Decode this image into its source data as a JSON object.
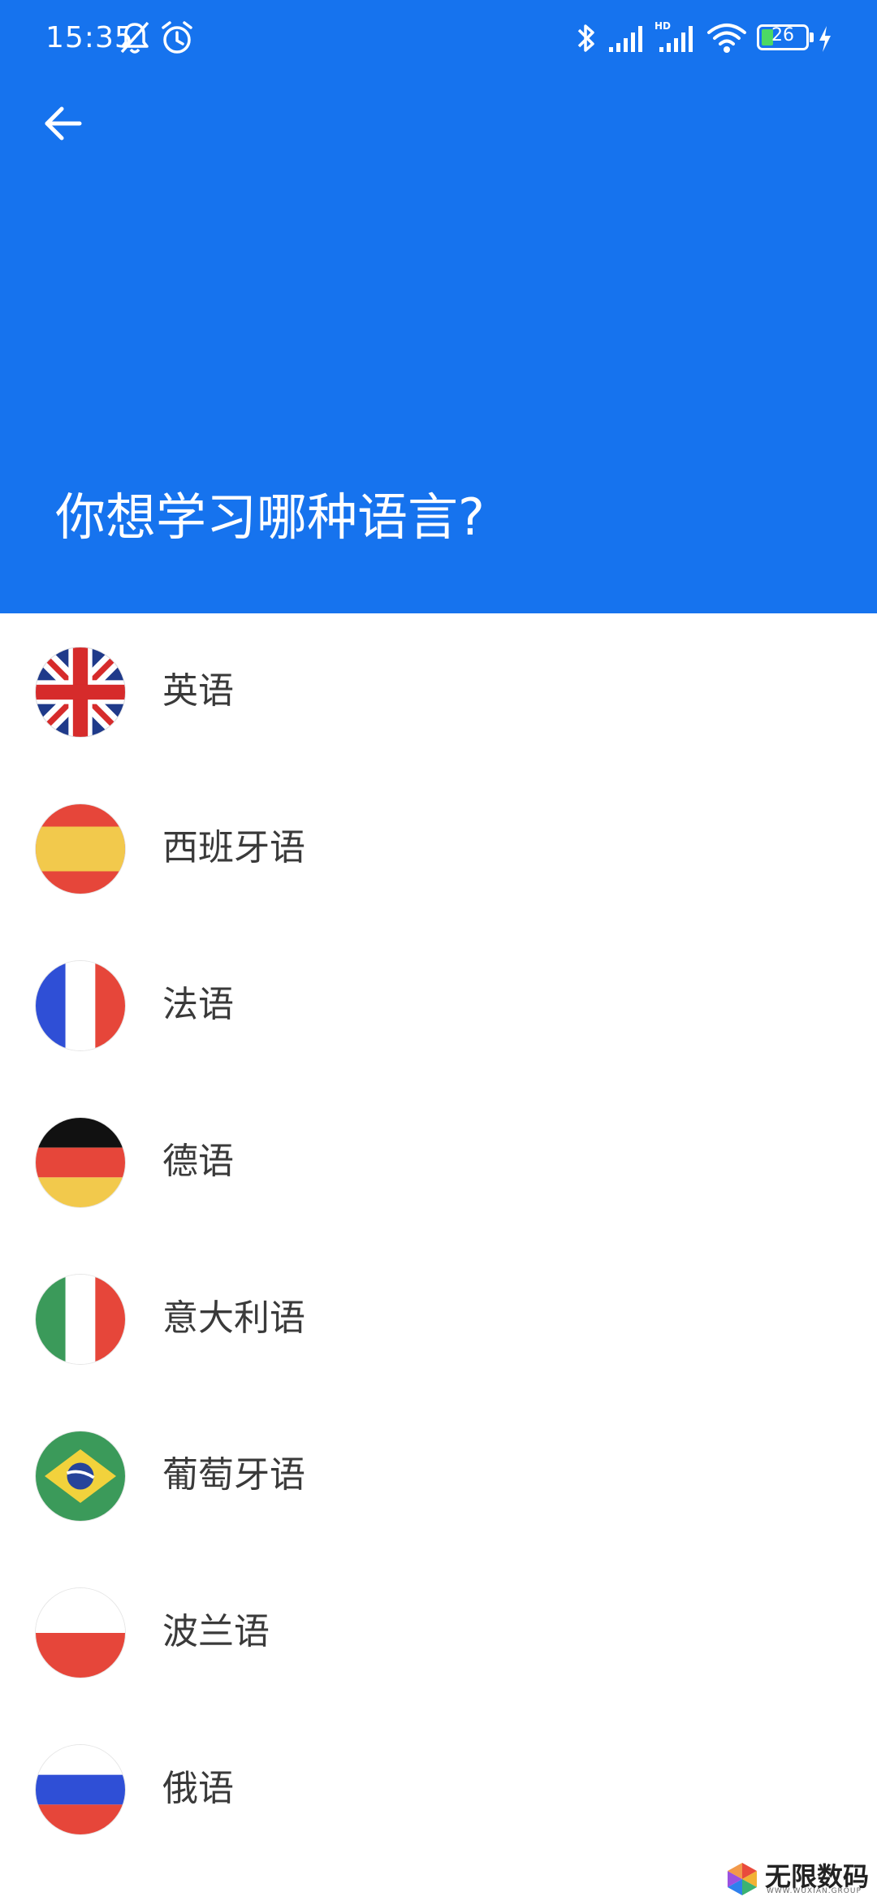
{
  "status_bar": {
    "time": "15:35",
    "battery_level": "26",
    "icons": [
      "bell-off-icon",
      "alarm-icon",
      "bluetooth-icon",
      "signal-icon",
      "hd-signal-icon",
      "wifi-icon",
      "battery-icon",
      "charging-icon"
    ]
  },
  "header": {
    "back_icon": "arrow-left-icon",
    "title": "你想学习哪种语言?",
    "background_color": "#1673ee"
  },
  "languages": [
    {
      "label": "英语",
      "flag": "uk-flag-icon"
    },
    {
      "label": "西班牙语",
      "flag": "spain-flag-icon"
    },
    {
      "label": "法语",
      "flag": "france-flag-icon"
    },
    {
      "label": "德语",
      "flag": "germany-flag-icon"
    },
    {
      "label": "意大利语",
      "flag": "italy-flag-icon"
    },
    {
      "label": "葡萄牙语",
      "flag": "brazil-flag-icon"
    },
    {
      "label": "波兰语",
      "flag": "poland-flag-icon"
    },
    {
      "label": "俄语",
      "flag": "russia-flag-icon"
    }
  ],
  "watermark": {
    "text": "无限数码",
    "subtext": "WWW.WUXIAN.GROUP"
  }
}
